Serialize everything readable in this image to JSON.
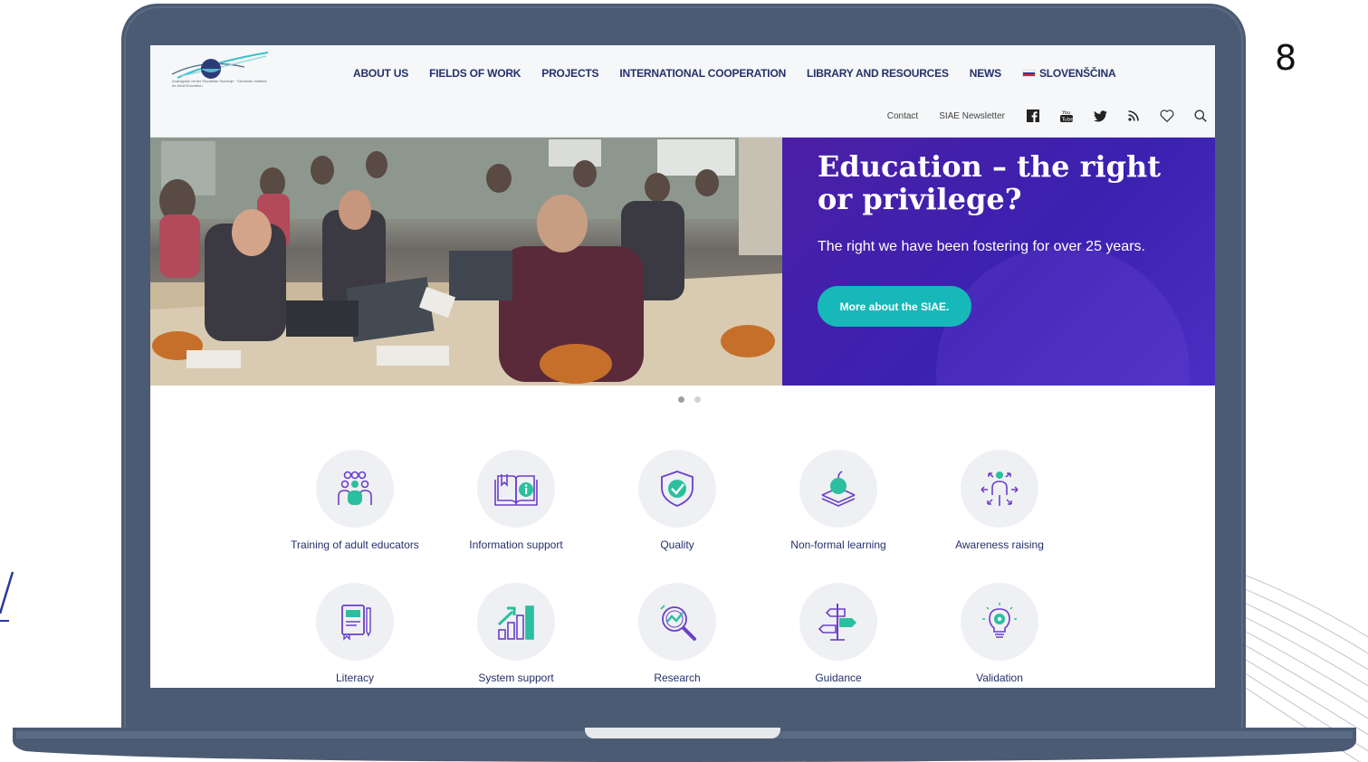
{
  "slide_number": "8",
  "site": {
    "logo_text": "Andragoški center Republike Slovenije · Slovenian Institute for Adult Education",
    "nav": [
      {
        "label": "ABOUT US"
      },
      {
        "label": "FIELDS OF WORK"
      },
      {
        "label": "PROJECTS"
      },
      {
        "label": "INTERNATIONAL COOPERATION"
      },
      {
        "label": "LIBRARY AND RESOURCES"
      },
      {
        "label": "NEWS"
      },
      {
        "label": "SLOVENŠČINA"
      }
    ],
    "util": {
      "contact": "Contact",
      "newsletter": "SIAE Newsletter",
      "icons": [
        "facebook-icon",
        "youtube-icon",
        "twitter-icon",
        "rss-icon",
        "heart-icon",
        "search-icon"
      ]
    }
  },
  "hero": {
    "title": "Education – the right or privilege?",
    "subtitle": "The right we have been fostering for over 25 years.",
    "button": "More about the SIAE.",
    "slides_total": 2,
    "active_slide": 1
  },
  "features": [
    {
      "label": "Training of adult educators",
      "icon": "people-group-icon"
    },
    {
      "label": "Information support",
      "icon": "info-book-icon"
    },
    {
      "label": "Quality",
      "icon": "shield-check-icon"
    },
    {
      "label": "Non-formal learning",
      "icon": "apple-books-icon"
    },
    {
      "label": "Awareness raising",
      "icon": "person-arrows-icon"
    },
    {
      "label": "Literacy",
      "icon": "notebook-icon"
    },
    {
      "label": "System support",
      "icon": "bar-chart-up-icon"
    },
    {
      "label": "Research",
      "icon": "magnifier-chart-icon"
    },
    {
      "label": "Guidance",
      "icon": "signpost-icon"
    },
    {
      "label": "Validation",
      "icon": "lightbulb-gear-icon"
    }
  ],
  "colors": {
    "frame": "#4b5b73",
    "nav_text": "#24306b",
    "hero_panel": "#3b21b0",
    "button": "#17b8b9",
    "icon_teal": "#2bbf9f",
    "icon_purple": "#6b3fc8"
  }
}
